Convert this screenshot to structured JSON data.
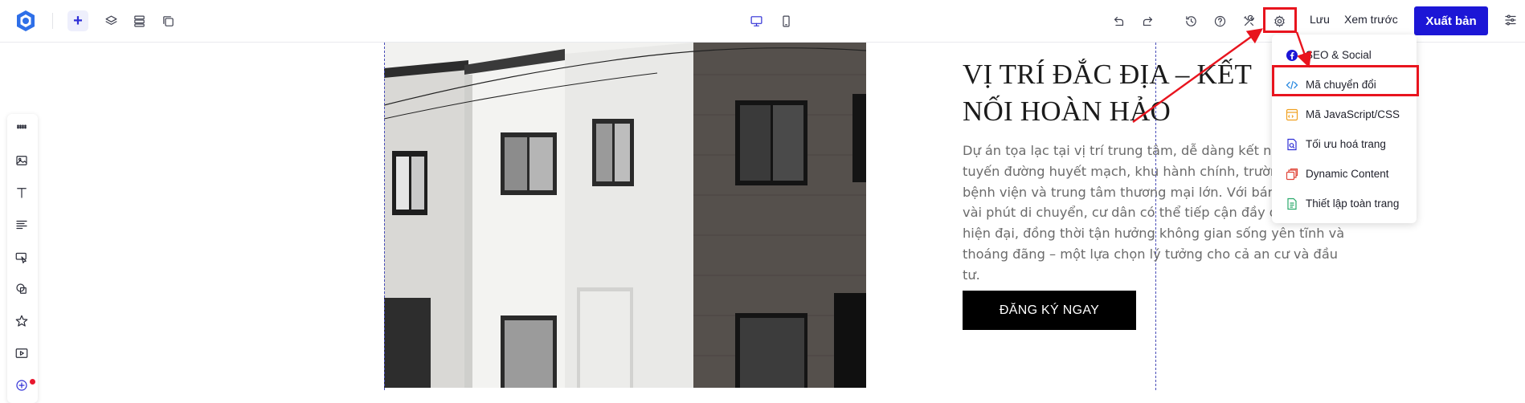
{
  "toolbar": {
    "logo_icon": "app-logo",
    "add_icon": "plus-icon",
    "layers_icon": "layers-icon",
    "sections_icon": "sections-icon",
    "pages_icon": "pages-icon",
    "desktop_icon": "desktop-icon",
    "mobile_icon": "mobile-icon",
    "undo_icon": "undo-icon",
    "redo_icon": "redo-icon",
    "history_icon": "history-icon",
    "help_icon": "help-icon",
    "tools_icon": "tools-icon",
    "settings_icon": "gear-icon",
    "save_label": "Lưu",
    "preview_label": "Xem trước",
    "publish_label": "Xuất bản",
    "more_icon": "sliders-icon",
    "accent_color": "#1c16d6"
  },
  "sidebar": {
    "items": [
      {
        "icon": "drag-handle-icon"
      },
      {
        "icon": "image-icon"
      },
      {
        "icon": "text-icon"
      },
      {
        "icon": "paragraph-icon"
      },
      {
        "icon": "button-icon"
      },
      {
        "icon": "shapes-icon"
      },
      {
        "icon": "star-icon"
      },
      {
        "icon": "video-icon"
      },
      {
        "icon": "add-circle-icon"
      }
    ]
  },
  "content": {
    "headline": "VỊ TRÍ ĐẮC ĐỊA – KẾT NỐI HOÀN HẢO",
    "body": "Dự án tọa lạc tại vị trí trung tâm, dễ dàng kết nối đến các tuyến đường huyết mạch, khu hành chính, trường học, bệnh viện và trung tâm thương mại lớn. Với bán kính chỉ vài phút di chuyển, cư dân có thể tiếp cận đầy đủ tiện ích hiện đại, đồng thời tận hưởng không gian sống yên tĩnh và thoáng đãng – một lựa chọn lý tưởng cho cả an cư và đầu tư.",
    "cta_label": "ĐĂNG KÝ NGAY"
  },
  "menu": {
    "items": [
      {
        "label": "SEO & Social",
        "icon": "facebook-icon",
        "color": "#1c16d6"
      },
      {
        "label": "Mã chuyển đổi",
        "icon": "code-icon",
        "color": "#2e8be0"
      },
      {
        "label": "Mã JavaScript/CSS",
        "icon": "js-css-icon",
        "color": "#f0a020"
      },
      {
        "label": "Tối ưu hoá trang",
        "icon": "page-optimize-icon",
        "color": "#2f2fd6"
      },
      {
        "label": "Dynamic Content",
        "icon": "dynamic-content-icon",
        "color": "#e0463a"
      },
      {
        "label": "Thiết lập toàn trang",
        "icon": "page-settings-icon",
        "color": "#2aa96b"
      }
    ]
  },
  "annotation_color": "#e8141e"
}
